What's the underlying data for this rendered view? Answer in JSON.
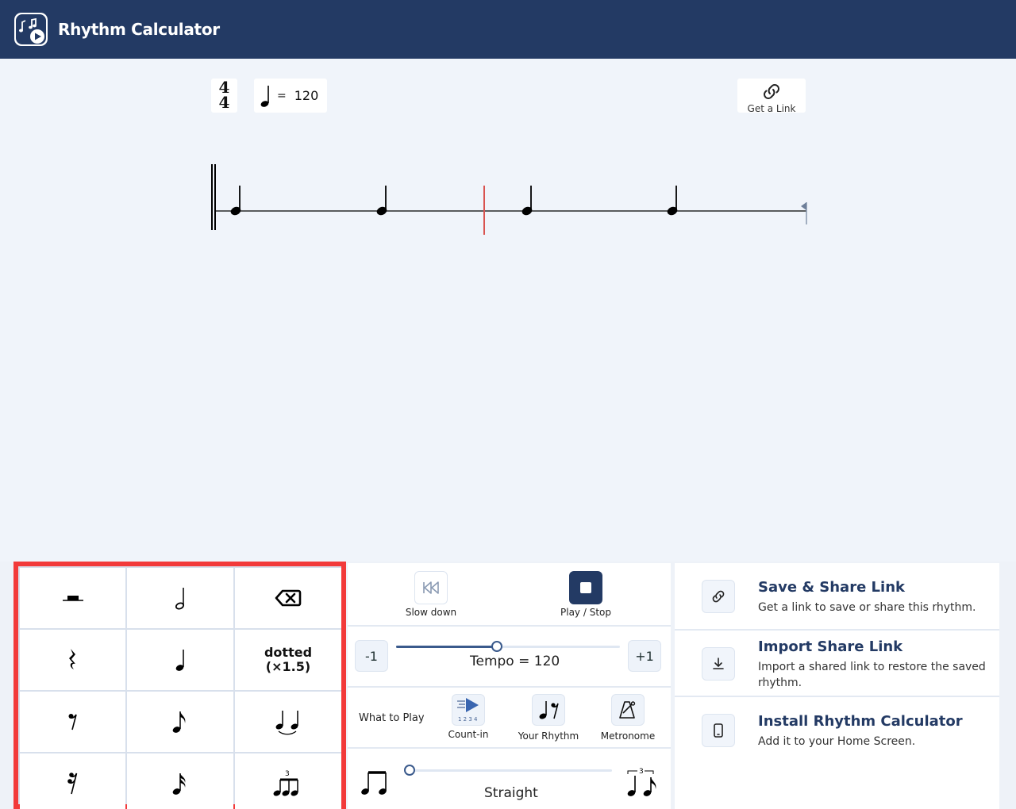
{
  "app": {
    "title": "Rhythm Calculator"
  },
  "score": {
    "time_signature": {
      "top": "4",
      "bottom": "4"
    },
    "tempo": {
      "equals": "=",
      "value": "120"
    },
    "get_link_label": "Get a Link"
  },
  "keypad": {
    "dotted_label_1": "dotted",
    "dotted_label_2": "(×1.5)",
    "triplet_mark": "3"
  },
  "controls": {
    "slow_down_label": "Slow down",
    "play_stop_label": "Play / Stop",
    "minus_label": "-1",
    "plus_label": "+1",
    "tempo_caption": "Tempo = 120",
    "tempo_slider_value": 0.45,
    "what_to_play_label": "What to Play",
    "count_in_label": "Count-in",
    "count_in_digits": "1 2 3 4",
    "your_rhythm_label": "Your Rhythm",
    "metronome_label": "Metronome",
    "swing_caption": "Straight",
    "swing_slider_value": 0.0,
    "swing_triplet_mark": "3"
  },
  "side": {
    "items": [
      {
        "title": "Save & Share Link",
        "desc": "Get a link to save or share this rhythm."
      },
      {
        "title": "Import Share Link",
        "desc": "Import a shared link to restore the saved rhythm."
      },
      {
        "title": "Install Rhythm Calculator",
        "desc": "Add it to your Home Screen."
      }
    ]
  },
  "colors": {
    "header": "#233a64",
    "accent": "#3a5a8c",
    "highlight_border": "#f23a3a",
    "cursor": "#d9534f"
  }
}
